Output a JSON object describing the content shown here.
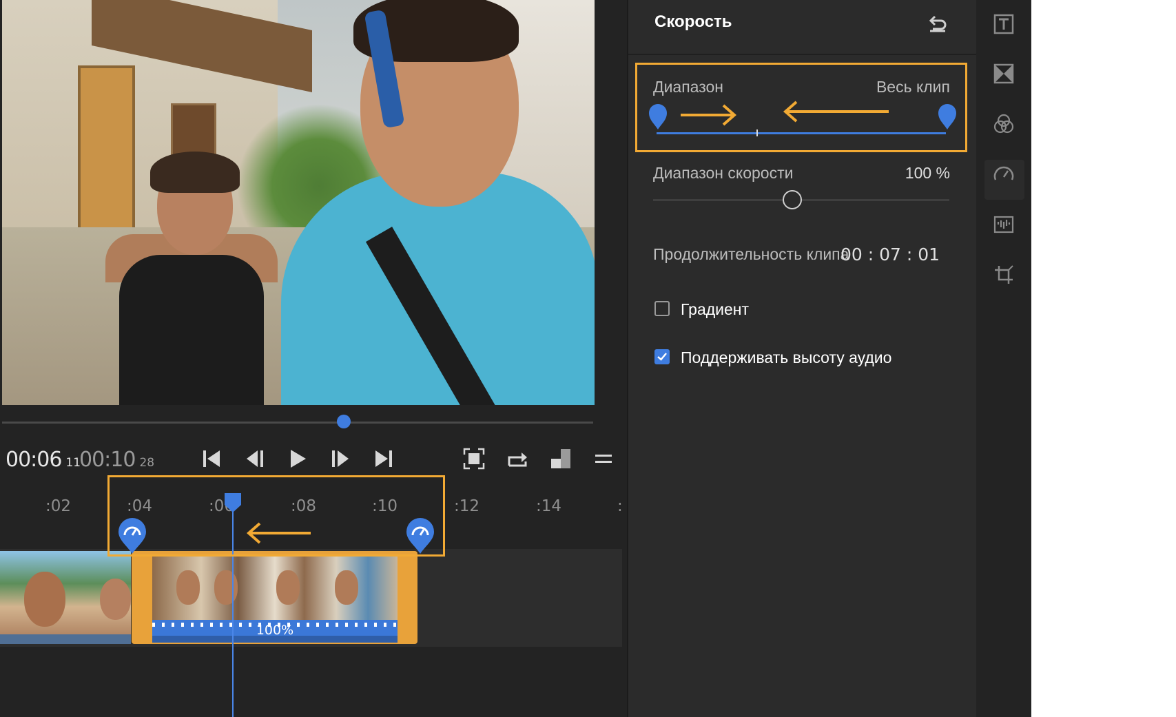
{
  "panel": {
    "title": "Скорость",
    "range_label": "Диапазон",
    "whole_clip_label": "Весь клип",
    "speed_range_label": "Диапазон скорости",
    "speed_value": "100 %",
    "speed_slider_fraction": 0.47,
    "clip_duration_label": "Продолжительность клипа",
    "clip_duration_value": "00 : 07 : 01",
    "gradient_label": "Градиент",
    "gradient_checked": false,
    "keep_pitch_label": "Поддерживать высоту аудио",
    "keep_pitch_checked": true
  },
  "transport": {
    "current_time": "00:06",
    "current_frames": "11",
    "total_time": "00:10",
    "total_frames": "28"
  },
  "timeline": {
    "ruler": [
      ":02",
      ":04",
      ":06",
      ":08",
      ":10",
      ":12",
      ":14",
      ":"
    ],
    "clip_speed_label": "100%"
  },
  "colors": {
    "accent_blue": "#3f7de0",
    "highlight_orange": "#f2aa34",
    "panel_bg": "#2b2b2b",
    "app_bg": "#232323"
  },
  "icons": [
    "text-icon",
    "transition-icon",
    "color-icon",
    "speed-icon",
    "audio-icon",
    "crop-icon"
  ]
}
